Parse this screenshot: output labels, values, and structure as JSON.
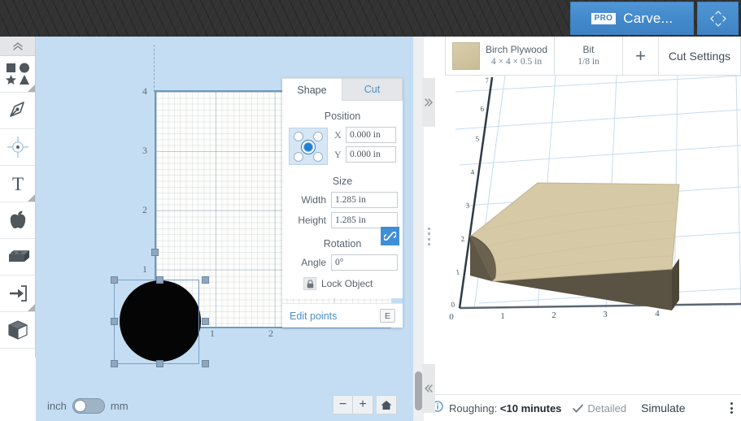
{
  "topbar": {
    "pro_badge": "PRO",
    "carve_label": "Carve...",
    "expand_icon": "expand-arrows-icon"
  },
  "toolbar": {
    "collapse_icon": "double-chevron-up-icon",
    "items": [
      {
        "name": "shapes-tool",
        "icon": "shapes-icon",
        "has_submenu": true
      },
      {
        "name": "pen-tool",
        "icon": "pen-nib-icon",
        "has_submenu": false
      },
      {
        "name": "alignment-tool",
        "icon": "crosshair-target-icon",
        "has_submenu": false
      },
      {
        "name": "text-tool",
        "icon": "text-t-icon",
        "has_submenu": true
      },
      {
        "name": "clipart-tool",
        "icon": "apple-icon",
        "has_submenu": false
      },
      {
        "name": "app-tool",
        "icon": "lego-block-icon",
        "has_submenu": false
      },
      {
        "name": "import-tool",
        "icon": "import-arrow-icon",
        "has_submenu": true
      },
      {
        "name": "threed-tool",
        "icon": "cube-icon",
        "has_submenu": false
      }
    ]
  },
  "canvas": {
    "y_labels": [
      "4",
      "3",
      "2",
      "1"
    ],
    "x_labels": [
      "1",
      "2"
    ],
    "selected_shape": "circle"
  },
  "units": {
    "left_label": "inch",
    "right_label": "mm",
    "selected": "inch",
    "zoom_out": "−",
    "zoom_in": "+",
    "home_icon": "home-icon"
  },
  "panel": {
    "tabs": [
      {
        "label": "Shape",
        "active": true
      },
      {
        "label": "Cut",
        "active": false
      }
    ],
    "position": {
      "title": "Position",
      "anchor_selected": "center",
      "x_label": "X",
      "x_value": "0.000 in",
      "y_label": "Y",
      "y_value": "0.000 in"
    },
    "size": {
      "title": "Size",
      "width_label": "Width",
      "width_value": "1.285 in",
      "height_label": "Height",
      "height_value": "1.285 in",
      "link_icon": "chain-link-icon"
    },
    "rotation": {
      "title": "Rotation",
      "angle_label": "Angle",
      "angle_value": "0°"
    },
    "lock": {
      "icon": "padlock-icon",
      "label": "Lock Object"
    },
    "edit_points": {
      "label": "Edit points",
      "shortcut": "E"
    },
    "expand_icon": "double-chevron-right-icon",
    "collapse_icon": "double-chevron-left-icon"
  },
  "preview": {
    "material": {
      "name": "Birch Plywood",
      "dimensions": "4 × 4 × 0.5 in",
      "swatch_color": "#d2c6a3"
    },
    "bit": {
      "label": "Bit",
      "value": "1/8 in"
    },
    "add_label": "+",
    "cut_settings_label": "Cut Settings",
    "axes": {
      "x_ticks": [
        "0",
        "1",
        "2",
        "3",
        "4"
      ],
      "y_ticks": [
        "0",
        "1",
        "2",
        "3",
        "4",
        "5",
        "6",
        "7"
      ]
    }
  },
  "status": {
    "info_icon": "info-icon",
    "roughing_label": "Roughing:",
    "roughing_value": "<10 minutes",
    "check_icon": "check-icon",
    "detailed_label": "Detailed",
    "simulate_label": "Simulate",
    "menu_icon": "kebab-menu-icon"
  }
}
